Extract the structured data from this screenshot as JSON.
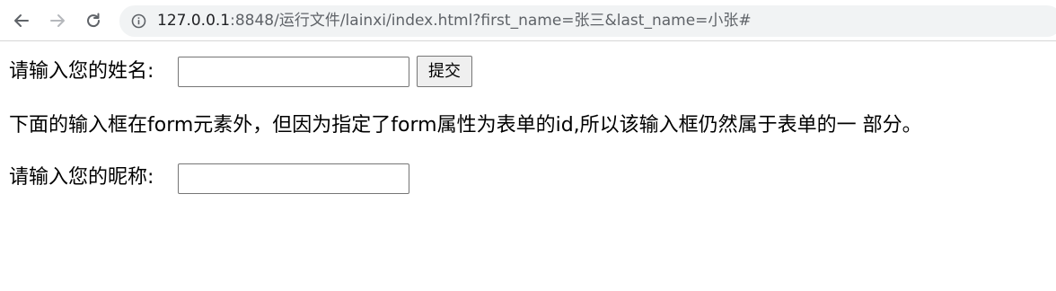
{
  "browser": {
    "url_host": "127.0.0.1",
    "url_rest": ":8848/运行文件/lainxi/index.html?first_name=张三&last_name=小张#"
  },
  "page": {
    "name_label": "请输入您的姓名:",
    "name_value": "",
    "submit_label": "提交",
    "note_text": "下面的输入框在form元素外，但因为指定了form属性为表单的id,所以该输入框仍然属于表单的一 部分。",
    "nickname_label": "请输入您的昵称:",
    "nickname_value": ""
  }
}
